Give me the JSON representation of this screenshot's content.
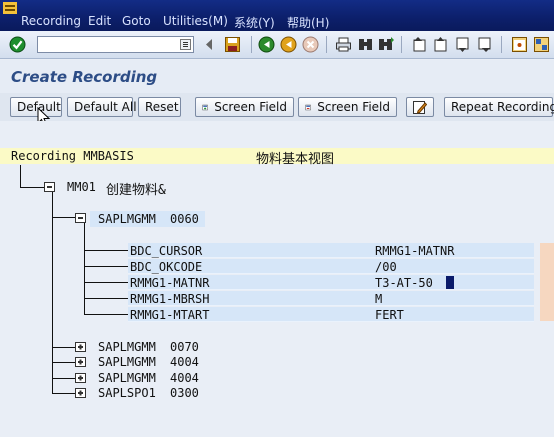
{
  "menu": [
    "Recording",
    "Edit",
    "Goto",
    "Utilities(M)",
    "系统(Y)",
    "帮助(H)"
  ],
  "toolbar": {
    "command_value": "",
    "icons": [
      "enter-icon",
      "save-icon",
      "back-icon",
      "exit-icon",
      "cancel-icon",
      "print-icon",
      "find-icon",
      "find-next-icon",
      "first-page-icon",
      "prev-page-icon",
      "next-page-icon",
      "last-page-icon",
      "new-session-icon",
      "shortcut-icon"
    ]
  },
  "title": "Create Recording",
  "app_buttons": {
    "default": "Default",
    "default_all": "Default All",
    "reset": "Reset",
    "screen_field_add": "Screen Field",
    "screen_field_del": "Screen Field",
    "repeat_recording": "Repeat Recording"
  },
  "recording": {
    "label": "Recording MMBASIS",
    "description": "物料基本视图"
  },
  "tree": {
    "root_code": "MM01",
    "root_desc": "创建物料&",
    "screens": [
      {
        "program": "SAPLMGMM",
        "dynpro": "0060",
        "expanded": true
      },
      {
        "program": "SAPLMGMM",
        "dynpro": "0070",
        "expanded": false
      },
      {
        "program": "SAPLMGMM",
        "dynpro": "4004",
        "expanded": false
      },
      {
        "program": "SAPLMGMM",
        "dynpro": "4004",
        "expanded": false
      },
      {
        "program": "SAPLSPO1",
        "dynpro": "0300",
        "expanded": false
      }
    ],
    "fields": [
      {
        "name": "BDC_CURSOR",
        "value": "RMMG1-MATNR"
      },
      {
        "name": "BDC_OKCODE",
        "value": "/00"
      },
      {
        "name": "RMMG1-MATNR",
        "value": "T3-AT-50"
      },
      {
        "name": "RMMG1-MBRSH",
        "value": "M"
      },
      {
        "name": "RMMG1-MTART",
        "value": "FERT"
      }
    ]
  },
  "colors": {
    "menubar": "#0c1f6a",
    "title_text": "#2d4d86",
    "header_band": "#fbfac6",
    "field_band": "#d6e6f8"
  }
}
